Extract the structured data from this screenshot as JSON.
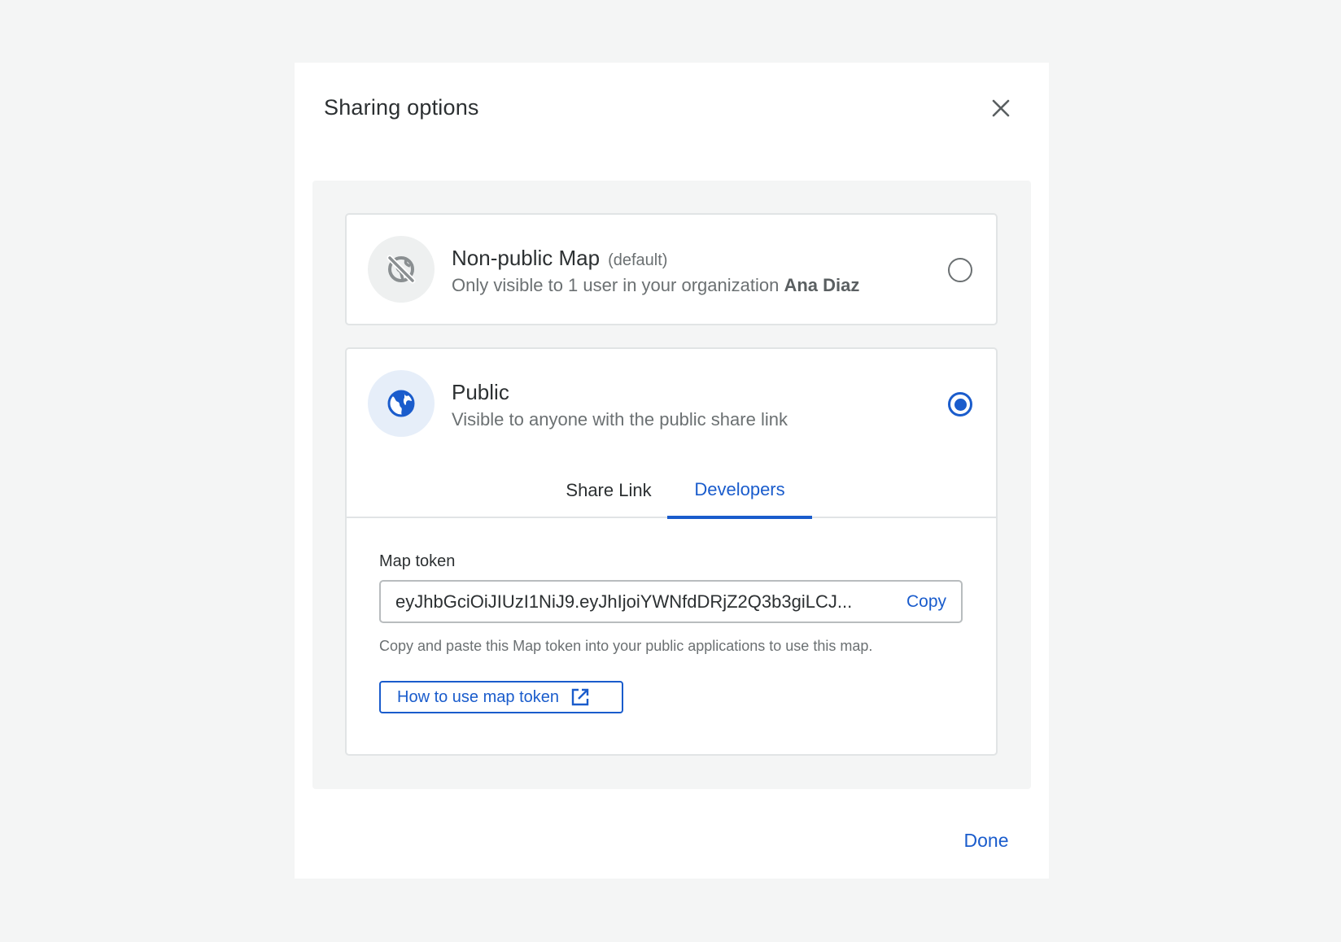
{
  "dialog": {
    "title": "Sharing options",
    "close_icon": "close-icon",
    "done_label": "Done"
  },
  "options": {
    "nonpublic": {
      "title": "Non-public Map",
      "tag": "(default)",
      "desc_prefix": "Only visible to 1 user in your organization",
      "desc_user": "Ana Diaz",
      "icon": "globe-off-icon",
      "selected": false
    },
    "public": {
      "title": "Public",
      "desc": "Visible to anyone with the public share link",
      "icon": "globe-icon",
      "selected": true
    }
  },
  "tabs": [
    {
      "label": "Share Link",
      "active": false
    },
    {
      "label": "Developers",
      "active": true
    }
  ],
  "developers": {
    "field_label": "Map token",
    "token_value": "eyJhbGciOiJIUzI1NiJ9.eyJhIjoiYWNfdDRjZ2Q3b3giLCJ...",
    "copy_label": "Copy",
    "hint": "Copy and paste this Map token into your public applications to use this map.",
    "howto_label": "How to use map token",
    "howto_icon": "external-link-icon"
  },
  "colors": {
    "accent": "#1a5ccc",
    "background": "#f4f5f5",
    "text": "#2c3032",
    "muted": "#6b7072"
  }
}
